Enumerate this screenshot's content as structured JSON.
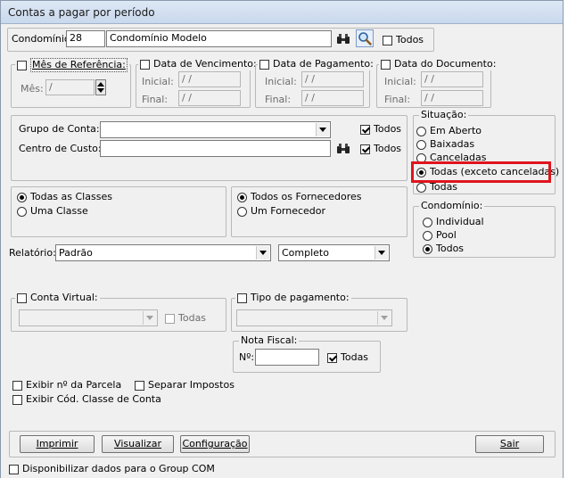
{
  "window": {
    "title": "Contas a pagar por período"
  },
  "condominio": {
    "label": "Condomínio:",
    "code": "28",
    "name": "Condomínio Modelo",
    "todos_label": "Todos"
  },
  "mes_ref": {
    "label": "Mês de Referência:",
    "mes_label": "Mês:",
    "mes_value": "  /"
  },
  "data_vencimento": {
    "label": "Data de Vencimento:",
    "inicial_label": "Inicial:",
    "final_label": "Final:",
    "inicial_value": " / /",
    "final_value": " / /"
  },
  "data_pagamento": {
    "label": "Data de Pagamento:",
    "inicial_label": "Inicial:",
    "final_label": "Final:",
    "inicial_value": " / /",
    "final_value": " / /"
  },
  "data_documento": {
    "label": "Data do Documento:",
    "inicial_label": "Inicial:",
    "final_label": "Final:",
    "inicial_value": " / /",
    "final_value": " / /"
  },
  "grupo_conta": {
    "label": "Grupo de Conta:",
    "todos_label": "Todos"
  },
  "centro_custo": {
    "label": "Centro de Custo:",
    "todos_label": "Todos"
  },
  "situacao": {
    "label": "Situação:",
    "options": [
      "Em Aberto",
      "Baixadas",
      "Canceladas",
      "Todas (exceto canceladas)",
      "Todas"
    ],
    "selected": "Todas (exceto canceladas)"
  },
  "classes": {
    "all_label": "Todas as Classes",
    "one_label": "Uma Classe"
  },
  "fornecedores": {
    "all_label": "Todos os Fornecedores",
    "one_label": "Um Fornecedor"
  },
  "condominio_tipo": {
    "label": "Condomínio:",
    "options": [
      "Individual",
      "Pool",
      "Todos"
    ],
    "selected": "Todos"
  },
  "relatorio": {
    "label": "Relatório:",
    "value": "Padrão",
    "mode_value": "Completo"
  },
  "conta_virtual": {
    "label": "Conta Virtual:",
    "todas_label": "Todas"
  },
  "tipo_pagamento": {
    "label": "Tipo de pagamento:"
  },
  "nota_fiscal": {
    "label": "Nota Fiscal:",
    "numero_label": "Nº:",
    "todas_label": "Todas"
  },
  "options": {
    "exibir_parcela": "Exibir nº da Parcela",
    "separar_impostos": "Separar Impostos",
    "exibir_cod_classe": "Exibir Cód. Classe de Conta"
  },
  "buttons": {
    "imprimir": "Imprimir",
    "visualizar": "Visualizar",
    "configuracao": "Configuração",
    "sair": "Sair"
  },
  "footer": {
    "group_com_label": "Disponibilizar dados para o Group COM"
  },
  "colors": {
    "highlight": "#e0141e",
    "window_bg": "#f0f0f0"
  }
}
